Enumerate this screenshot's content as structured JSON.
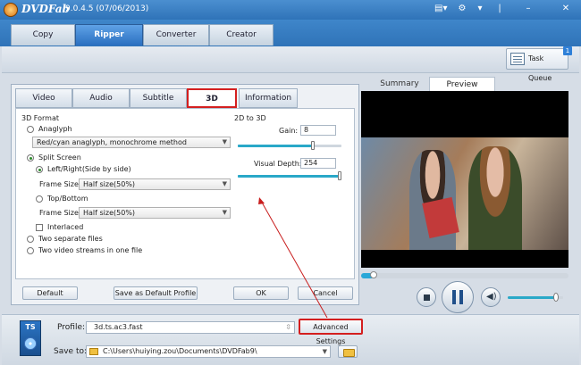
{
  "titlebar": {
    "brand": "DVDFab",
    "version": "9.0.4.5 (07/06/2013)"
  },
  "main_tabs": [
    {
      "label": "Copy"
    },
    {
      "label": "Ripper"
    },
    {
      "label": "Converter"
    },
    {
      "label": "Creator"
    }
  ],
  "toolbar": {
    "task_queue": "Task Queue",
    "task_queue_count": "1"
  },
  "settings_tabs": [
    {
      "label": "Video"
    },
    {
      "label": "Audio"
    },
    {
      "label": "Subtitle"
    },
    {
      "label": "3D"
    },
    {
      "label": "Information"
    }
  ],
  "format": {
    "heading": "3D Format",
    "anaglyph": "Anaglyph",
    "anaglyph_method": "Red/cyan anaglyph, monochrome method",
    "split_screen": "Split Screen",
    "left_right": "Left/Right(Side by side)",
    "frame_size_label": "Frame Size",
    "frame_size_value": "Half size(50%)",
    "top_bottom": "Top/Bottom",
    "frame_size_label_2": "Frame Size",
    "frame_size_value_2": "Half size(50%)",
    "interlaced": "Interlaced",
    "two_files": "Two separate files",
    "two_streams": "Two video streams in one file"
  },
  "two_d_to_three_d": {
    "heading": "2D to 3D",
    "gain_label": "Gain:",
    "gain_value": "8",
    "gain_level": 0.72,
    "depth_label": "Visual Depth:",
    "depth_value": "254",
    "depth_level": 0.98
  },
  "buttons": {
    "default": "Default",
    "save_default": "Save as Default Profile",
    "ok": "OK",
    "cancel": "Cancel"
  },
  "preview": {
    "tab_summary": "Summary",
    "tab_preview": "Preview",
    "seek_level": 0.06,
    "volume_level": 0.85
  },
  "bottom": {
    "profile_label": "Profile:",
    "profile_value": "3d.ts.ac3.fast",
    "advanced_settings": "Advanced Settings",
    "ts_badge": "TS",
    "saveto_label": "Save to:",
    "saveto_value": "C:\\Users\\huiying.zou\\Documents\\DVDFab9\\"
  },
  "colors": {
    "accent": "#2f73b8",
    "highlight": "#d41f1f",
    "slider": "#29a8c8"
  }
}
